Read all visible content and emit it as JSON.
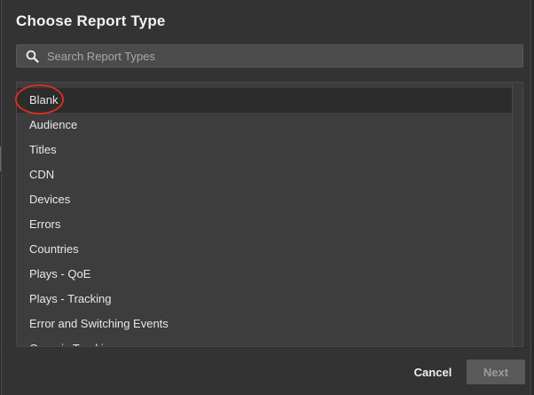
{
  "dialog": {
    "title": "Choose Report Type"
  },
  "search": {
    "placeholder": "Search Report Types",
    "value": ""
  },
  "report_types": [
    {
      "label": "Blank",
      "selected": true
    },
    {
      "label": "Audience",
      "selected": false
    },
    {
      "label": "Titles",
      "selected": false
    },
    {
      "label": "CDN",
      "selected": false
    },
    {
      "label": "Devices",
      "selected": false
    },
    {
      "label": "Errors",
      "selected": false
    },
    {
      "label": "Countries",
      "selected": false
    },
    {
      "label": "Plays - QoE",
      "selected": false
    },
    {
      "label": "Plays - Tracking",
      "selected": false
    },
    {
      "label": "Error and Switching Events",
      "selected": false
    },
    {
      "label": "Organic Tracking",
      "selected": false
    }
  ],
  "buttons": {
    "cancel": "Cancel",
    "next": "Next",
    "next_disabled": true
  },
  "colors": {
    "highlight_circle": "#d1301f",
    "selected_row": "#2c2c2c",
    "dialog_bg": "#333333"
  },
  "icons": {
    "search": "search-icon"
  }
}
